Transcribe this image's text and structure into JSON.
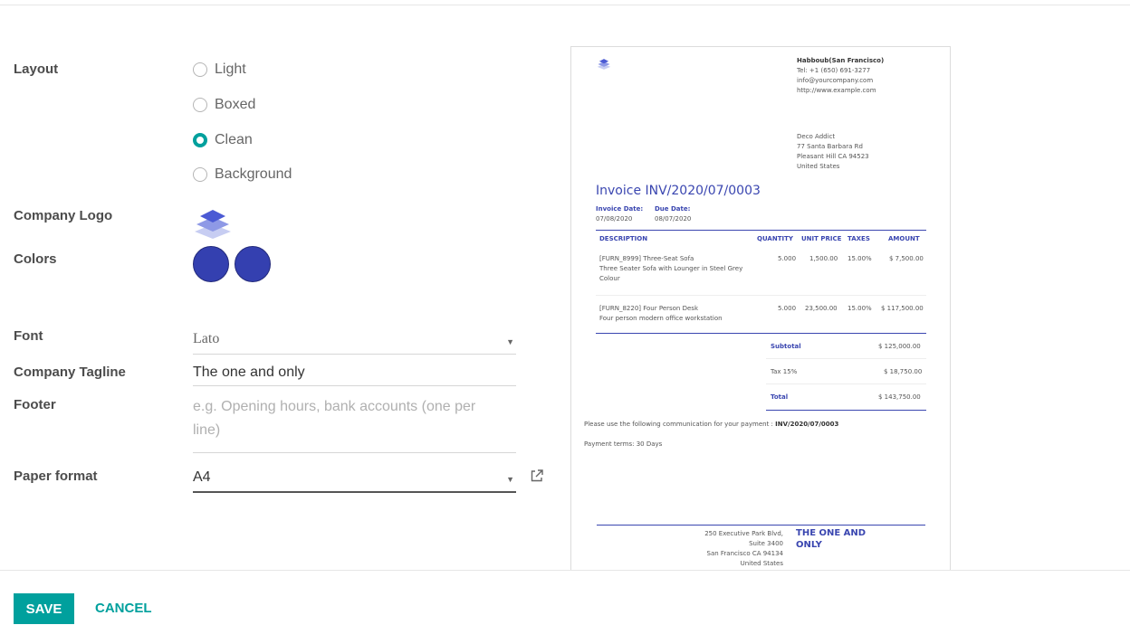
{
  "form": {
    "layout_label": "Layout",
    "layout_options": [
      {
        "label": "Light",
        "checked": false
      },
      {
        "label": "Boxed",
        "checked": false
      },
      {
        "label": "Clean",
        "checked": true
      },
      {
        "label": "Background",
        "checked": false
      }
    ],
    "company_logo_label": "Company Logo",
    "colors_label": "Colors",
    "colors": [
      "#3440b0",
      "#3440b0"
    ],
    "font_label": "Font",
    "font_value": "Lato",
    "tagline_label": "Company Tagline",
    "tagline_value": "The one and only",
    "footer_label": "Footer",
    "footer_placeholder": "e.g. Opening hours, bank accounts (one per line)",
    "paper_format_label": "Paper format",
    "paper_format_value": "A4"
  },
  "preview": {
    "company_name": "Habboub(San Francisco)",
    "company_tel": "Tel: +1 (650) 691-3277",
    "company_email": "info@yourcompany.com",
    "company_web": "http://www.example.com",
    "customer": [
      "Deco Addict",
      "77 Santa Barbara Rd",
      "Pleasant Hill CA 94523",
      "United States"
    ],
    "invoice_title": "Invoice INV/2020/07/0003",
    "invoice_date_label": "Invoice Date:",
    "invoice_date": "07/08/2020",
    "due_date_label": "Due Date:",
    "due_date": "08/07/2020",
    "headers": {
      "description": "DESCRIPTION",
      "quantity": "QUANTITY",
      "unit_price": "UNIT PRICE",
      "taxes": "TAXES",
      "amount": "AMOUNT"
    },
    "lines": [
      {
        "desc1": "[FURN_8999] Three-Seat Sofa",
        "desc2": "Three Seater Sofa with Lounger in Steel Grey",
        "desc3": "Colour",
        "qty": "5.000",
        "price": "1,500.00",
        "tax": "15.00%",
        "amount": "$ 7,500.00"
      },
      {
        "desc1": "[FURN_8220] Four Person Desk",
        "desc2": "Four person modern office workstation",
        "desc3": "",
        "qty": "5.000",
        "price": "23,500.00",
        "tax": "15.00%",
        "amount": "$ 117,500.00"
      }
    ],
    "subtotal_label": "Subtotal",
    "subtotal": "$ 125,000.00",
    "tax_label": "Tax 15%",
    "tax": "$ 18,750.00",
    "total_label": "Total",
    "total": "$ 143,750.00",
    "communication_prefix": "Please use the following communication for your payment : ",
    "communication_ref": "INV/2020/07/0003",
    "payment_terms": "Payment terms: 30 Days",
    "footer_address": [
      "250 Executive Park Blvd,",
      "Suite 3400",
      "San Francisco CA 94134",
      "United States"
    ],
    "footer_tagline": "THE ONE AND ONLY"
  },
  "actions": {
    "save": "SAVE",
    "cancel": "CANCEL"
  },
  "accent_color": "#00a09d",
  "report_color": "#3a46b0"
}
